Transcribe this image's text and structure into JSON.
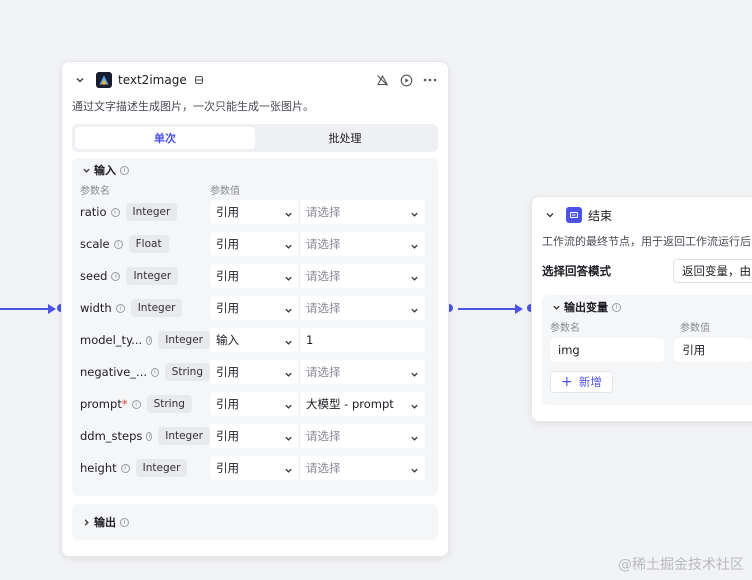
{
  "node1": {
    "title": "text2image",
    "description": "通过文字描述生成图片，一次只能生成一张图片。",
    "tabs": [
      "单次",
      "批处理"
    ],
    "input_section": {
      "title": "输入",
      "col_name": "参数名",
      "col_value": "参数值",
      "params": [
        {
          "name": "ratio",
          "required": false,
          "type": "Integer",
          "mode": "引用",
          "value": "请选择",
          "is_placeholder": true
        },
        {
          "name": "scale",
          "required": false,
          "type": "Float",
          "mode": "引用",
          "value": "请选择",
          "is_placeholder": true
        },
        {
          "name": "seed",
          "required": false,
          "type": "Integer",
          "mode": "引用",
          "value": "请选择",
          "is_placeholder": true
        },
        {
          "name": "width",
          "required": false,
          "type": "Integer",
          "mode": "引用",
          "value": "请选择",
          "is_placeholder": true
        },
        {
          "name": "model_ty...",
          "required": false,
          "type": "Integer",
          "mode": "输入",
          "value": "1",
          "is_placeholder": false
        },
        {
          "name": "negative_...",
          "required": false,
          "type": "String",
          "mode": "引用",
          "value": "请选择",
          "is_placeholder": true
        },
        {
          "name": "prompt",
          "required": true,
          "type": "String",
          "mode": "引用",
          "value": "大模型 - prompt",
          "is_placeholder": false
        },
        {
          "name": "ddm_steps",
          "required": false,
          "type": "Integer",
          "mode": "引用",
          "value": "请选择",
          "is_placeholder": true
        },
        {
          "name": "height",
          "required": false,
          "type": "Integer",
          "mode": "引用",
          "value": "请选择",
          "is_placeholder": true
        }
      ]
    },
    "output_section": {
      "title": "输出"
    }
  },
  "node2": {
    "title": "结束",
    "description": "工作流的最终节点，用于返回工作流运行后",
    "answer_mode_label": "选择回答模式",
    "answer_mode_value": "返回变量，由",
    "output_section": {
      "title": "输出变量",
      "col_name": "参数名",
      "col_value": "参数值",
      "var_name": "img",
      "var_mode": "引用",
      "add_label": "新增"
    }
  },
  "watermark": "@稀土掘金技术社区",
  "colors": {
    "accent": "#4d53e8",
    "node1_icon": "#1a1d2e",
    "node2_icon": "#4d53e8"
  },
  "icons": [
    "chevron-down-icon",
    "text2image-logo-icon",
    "database-icon",
    "bug-off-icon",
    "play-icon",
    "more-icon",
    "info-icon",
    "end-flag-icon",
    "plus-icon"
  ]
}
